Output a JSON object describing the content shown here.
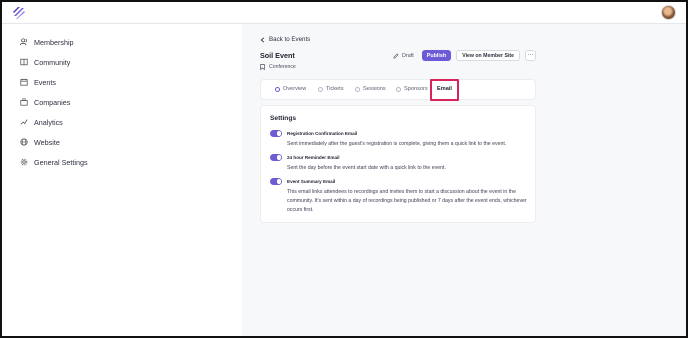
{
  "sidebar": {
    "items": [
      {
        "label": "Membership",
        "icon": "users-icon"
      },
      {
        "label": "Community",
        "icon": "book-icon"
      },
      {
        "label": "Events",
        "icon": "calendar-icon"
      },
      {
        "label": "Companies",
        "icon": "building-icon"
      },
      {
        "label": "Analytics",
        "icon": "chart-icon"
      },
      {
        "label": "Website",
        "icon": "globe-icon"
      },
      {
        "label": "General Settings",
        "icon": "gear-icon"
      }
    ]
  },
  "header": {
    "back_label": "Back to Events",
    "event_title": "Soil Event",
    "event_type": "Conference",
    "status": "Draft",
    "publish_label": "Publish",
    "view_label": "View on Member Site",
    "more_label": "···"
  },
  "tabs": [
    {
      "label": "Overview",
      "done": true
    },
    {
      "label": "Tickets",
      "done": false
    },
    {
      "label": "Sessions",
      "done": false
    },
    {
      "label": "Sponsors",
      "done": false
    },
    {
      "label": "Email",
      "active": true
    }
  ],
  "settings": {
    "title": "Settings",
    "items": [
      {
        "name": "Registration Confirmation Email",
        "enabled": true,
        "description": "Sent immediately after the guest's registration is complete, giving them a quick link to the event."
      },
      {
        "name": "24 hour Reminder Email",
        "enabled": true,
        "description": "Sent the day before the event start date with a quick link to the event."
      },
      {
        "name": "Event Summary Email",
        "enabled": true,
        "description": "This email links attendees to recordings and invites them to start a discussion about the event in the community. It's sent within a day of recordings being published or 7 days after the event ends, whichever occurs first."
      }
    ]
  },
  "colors": {
    "accent": "#6b5bd6",
    "highlight": "#d6245a"
  }
}
